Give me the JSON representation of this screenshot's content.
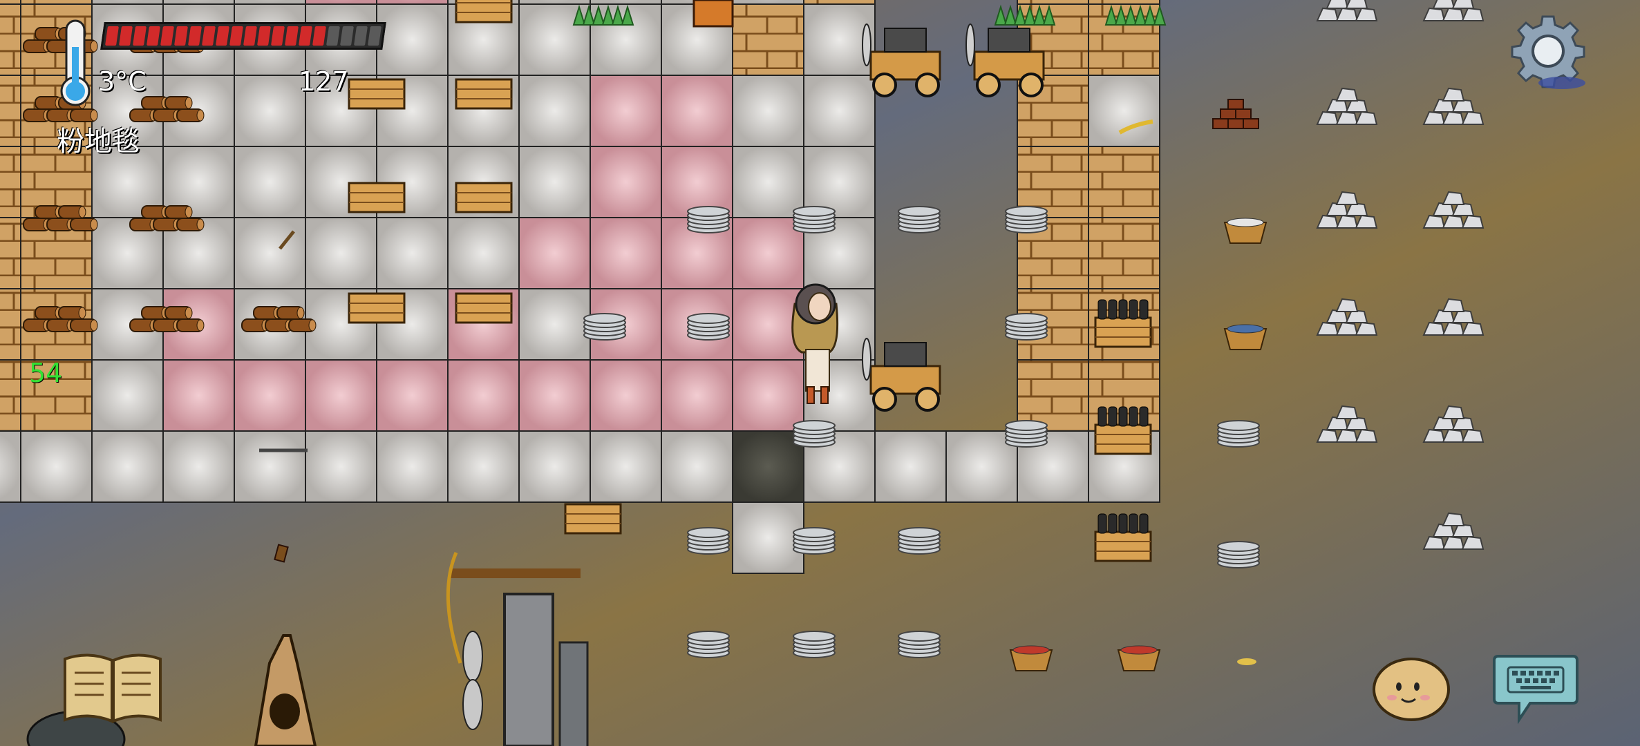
{
  "hud": {
    "temperature": "3°C",
    "tile_name": "粉地毯",
    "yum_count": "127",
    "age": "54",
    "food_pips_total": 20,
    "food_pips_filled": 16
  },
  "controls": {
    "settings": "gear-icon",
    "book": "book-icon",
    "emote": "emote-face-icon",
    "keyboard": "keyboard-icon"
  },
  "colors": {
    "food_bar": "#d22a2a",
    "age_text": "#33e033",
    "pink_carpet": "#dda7ae",
    "stone_floor": "#cfcdca"
  }
}
